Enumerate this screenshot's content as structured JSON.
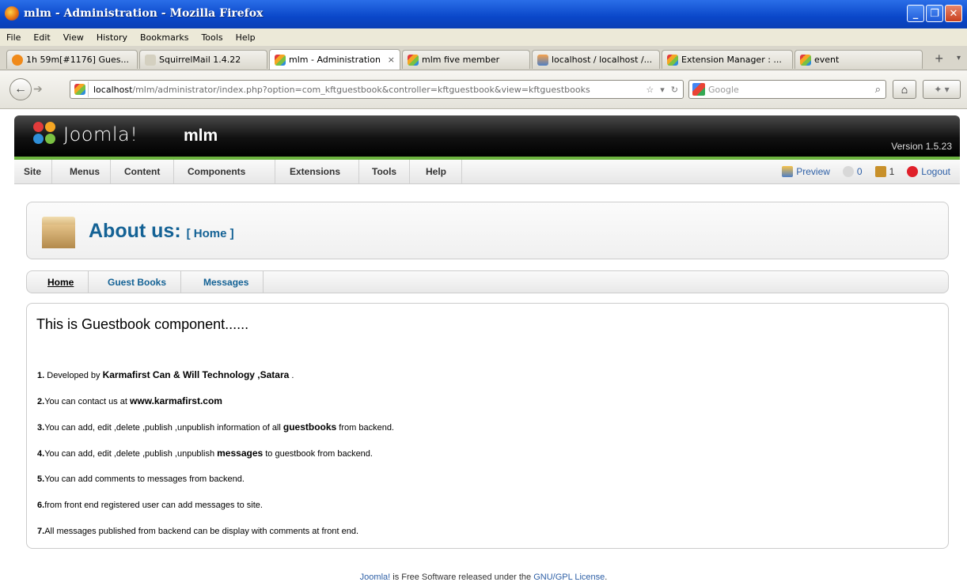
{
  "window": {
    "title": "mlm - Administration - Mozilla Firefox",
    "minimize": "_",
    "maximize": "❐",
    "close": "✕"
  },
  "menubar": [
    "File",
    "Edit",
    "View",
    "History",
    "Bookmarks",
    "Tools",
    "Help"
  ],
  "tabs": [
    {
      "label": "1h 59m[#1176] Gues...",
      "icon": "clock-icon"
    },
    {
      "label": "SquirrelMail 1.4.22",
      "icon": "squirrelmail-icon"
    },
    {
      "label": "mlm - Administration",
      "icon": "joomla-icon",
      "active": true
    },
    {
      "label": "mlm five member",
      "icon": "joomla-icon"
    },
    {
      "label": "localhost / localhost /...",
      "icon": "phpmyadmin-icon"
    },
    {
      "label": "Extension Manager : ...",
      "icon": "joomla-icon"
    },
    {
      "label": "event",
      "icon": "joomla-icon"
    }
  ],
  "tab_close": "×",
  "new_tab": "+",
  "url": {
    "host": "localhost",
    "rest": "/mlm/administrator/index.php?option=com_kftguestbook&controller=kftguestbook&view=kftguestbooks"
  },
  "search": {
    "placeholder": "Google"
  },
  "joomla": {
    "brand": "Joomla!",
    "site_name": "mlm",
    "version": "Version 1.5.23"
  },
  "admin_menu": [
    "Site",
    "Menus",
    "Content",
    "Components",
    "Extensions",
    "Tools",
    "Help"
  ],
  "status": {
    "preview": "Preview",
    "messages": "0",
    "users": "1",
    "logout": "Logout"
  },
  "page": {
    "title": "About us:",
    "subtitle": "[ Home ]"
  },
  "submenu": [
    "Home",
    "Guest Books",
    "Messages"
  ],
  "content": {
    "heading": "This is Guestbook component......",
    "points": [
      {
        "n": "1.",
        "pre": " Developed by ",
        "bold": "Karmafirst Can & Will Technology ,Satara",
        "post": " ."
      },
      {
        "n": "2.",
        "pre": "You can contact us at ",
        "bold": "www.karmafirst.com",
        "post": ""
      },
      {
        "n": "3.",
        "pre": "You can add, edit ,delete ,publish ,unpublish information of all ",
        "bold": "guestbooks",
        "post": " from backend."
      },
      {
        "n": "4.",
        "pre": "You can add, edit ,delete ,publish ,unpublish ",
        "bold": "messages",
        "post": " to guestbook from backend."
      },
      {
        "n": "5.",
        "pre": "You can add comments to messages from backend.",
        "bold": "",
        "post": ""
      },
      {
        "n": "6.",
        "pre": "from front end registered user can add messages to site.",
        "bold": "",
        "post": ""
      },
      {
        "n": "7.",
        "pre": "All messages published from backend can be display with comments at front end.",
        "bold": "",
        "post": ""
      }
    ]
  },
  "footer": {
    "link1": "Joomla!",
    "mid": " is Free Software released under the ",
    "link2": "GNU/GPL License",
    "end": "."
  },
  "colors": {
    "title_blue": "#146295",
    "link_blue": "#2d5fa6",
    "joomla_green": "#6cb33f"
  }
}
